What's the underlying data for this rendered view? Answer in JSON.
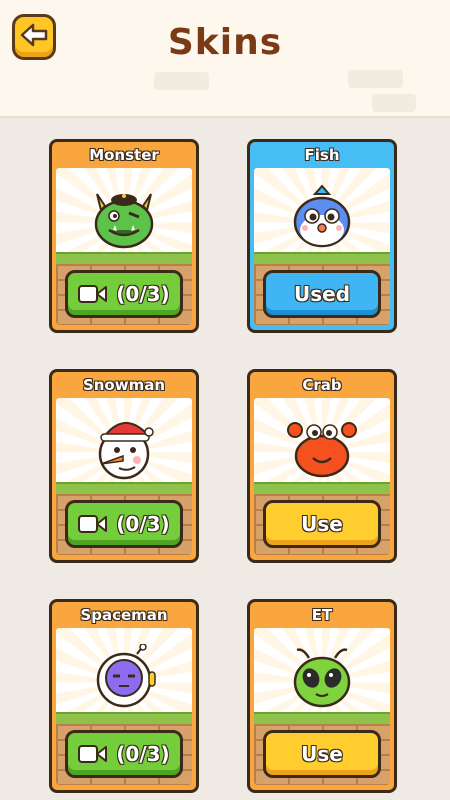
{
  "header": {
    "title": "Skins",
    "back_icon": "back-arrow-icon"
  },
  "colors": {
    "card_orange": "#f9a63e",
    "card_blue": "#47bdf5",
    "btn_green": "#74cd3a",
    "btn_blue": "#3fb6f3",
    "btn_yellow": "#ffcd2e",
    "title_brown": "#7a3a16"
  },
  "skins": [
    {
      "name": "Monster",
      "state": "locked",
      "action_label": "(0/3)",
      "icon": "video-icon"
    },
    {
      "name": "Fish",
      "state": "selected",
      "action_label": "Used"
    },
    {
      "name": "Snowman",
      "state": "locked",
      "action_label": "(0/3)",
      "icon": "video-icon"
    },
    {
      "name": "Crab",
      "state": "owned",
      "action_label": "Use"
    },
    {
      "name": "Spaceman",
      "state": "locked",
      "action_label": "(0/3)",
      "icon": "video-icon"
    },
    {
      "name": "ET",
      "state": "owned",
      "action_label": "Use"
    }
  ]
}
